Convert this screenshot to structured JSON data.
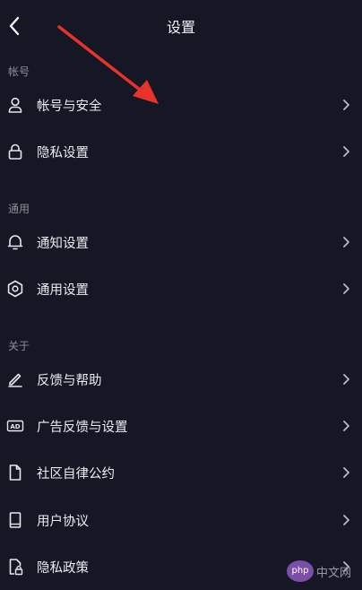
{
  "header": {
    "title": "设置",
    "back_icon": "chevron-left-icon"
  },
  "sections": [
    {
      "title": "帐号",
      "items": [
        {
          "label": "帐号与安全",
          "icon": "user-icon"
        },
        {
          "label": "隐私设置",
          "icon": "lock-icon"
        }
      ]
    },
    {
      "title": "通用",
      "items": [
        {
          "label": "通知设置",
          "icon": "bell-icon"
        },
        {
          "label": "通用设置",
          "icon": "gear-icon"
        }
      ]
    },
    {
      "title": "关于",
      "items": [
        {
          "label": "反馈与帮助",
          "icon": "edit-icon"
        },
        {
          "label": "广告反馈与设置",
          "icon": "ad-icon"
        },
        {
          "label": "社区自律公约",
          "icon": "document-icon"
        },
        {
          "label": "用户协议",
          "icon": "book-icon"
        },
        {
          "label": "隐私政策",
          "icon": "document-lock-icon"
        }
      ]
    }
  ],
  "annotation": {
    "color": "#e8332a"
  },
  "watermark": {
    "badge": "php",
    "text": "中文网"
  },
  "colors": {
    "background": "#161724",
    "text": "#ebebf0",
    "section_text": "#8d8e99",
    "chevron": "#b9bac4"
  }
}
